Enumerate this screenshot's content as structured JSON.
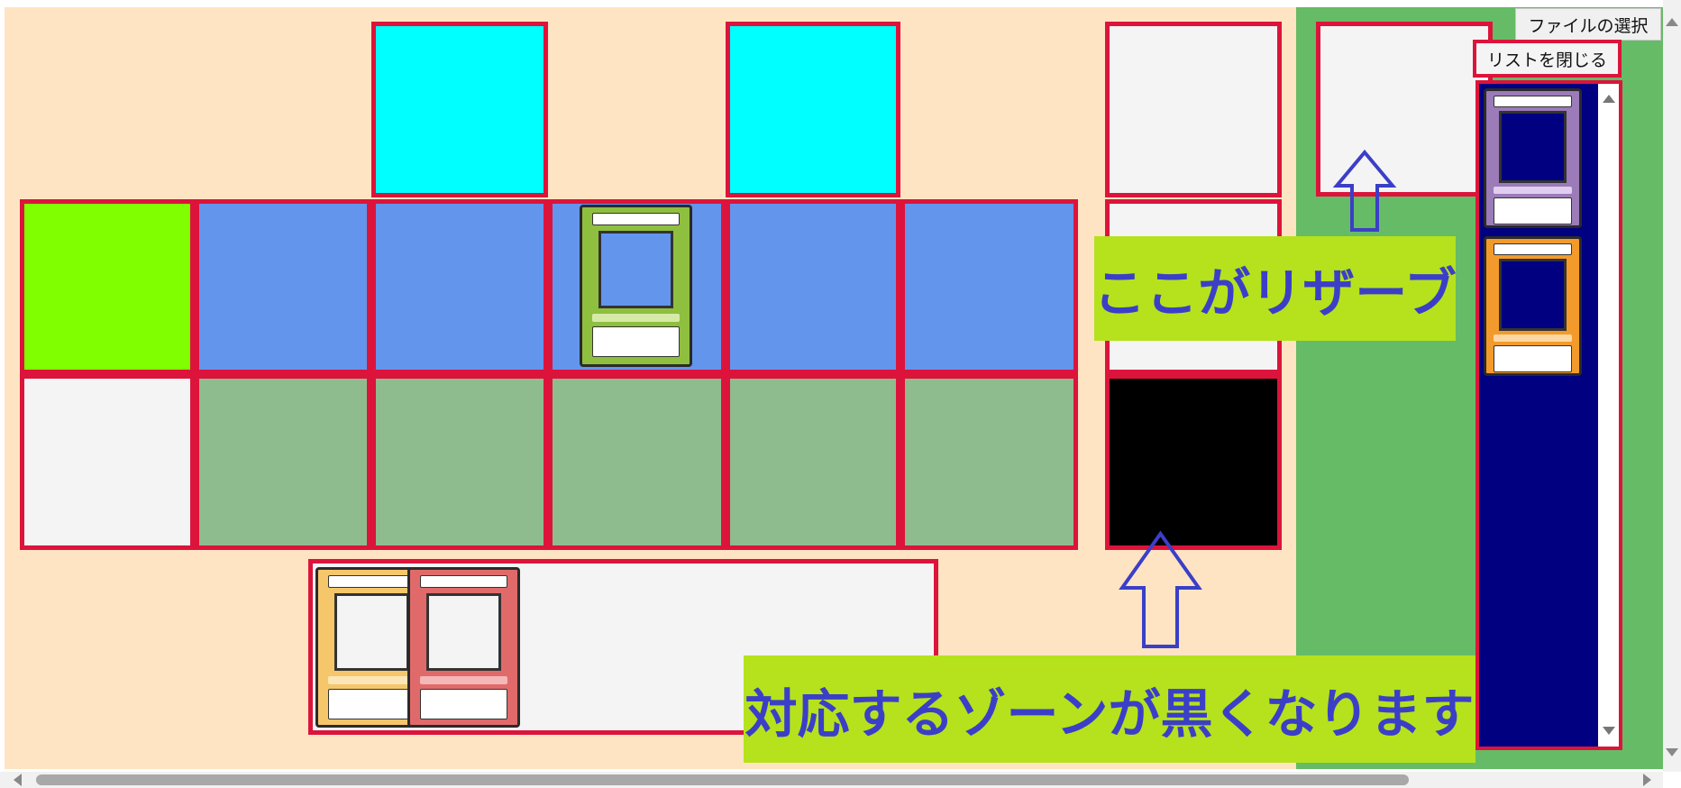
{
  "toolbar": {
    "file_select_label": "ファイルの選択",
    "close_list_label": "リストを閉じる"
  },
  "annotations": {
    "reserve_callout": "ここがリザーブ",
    "zone_callout": "対応するゾーンが黒くなります"
  },
  "colors": {
    "zone_border": "#dc143c",
    "board_bg": "#ffe4c4",
    "side_bg": "#66bb66",
    "annotation_bg": "#b5e21c",
    "annotation_text": "#3b3fc7",
    "arrow": "#3b3fc7"
  },
  "cards": {
    "field_card": "green-card",
    "hand_cards": [
      "yellow-card",
      "red-card"
    ],
    "list_cards": [
      "purple-card",
      "orange-card"
    ]
  }
}
